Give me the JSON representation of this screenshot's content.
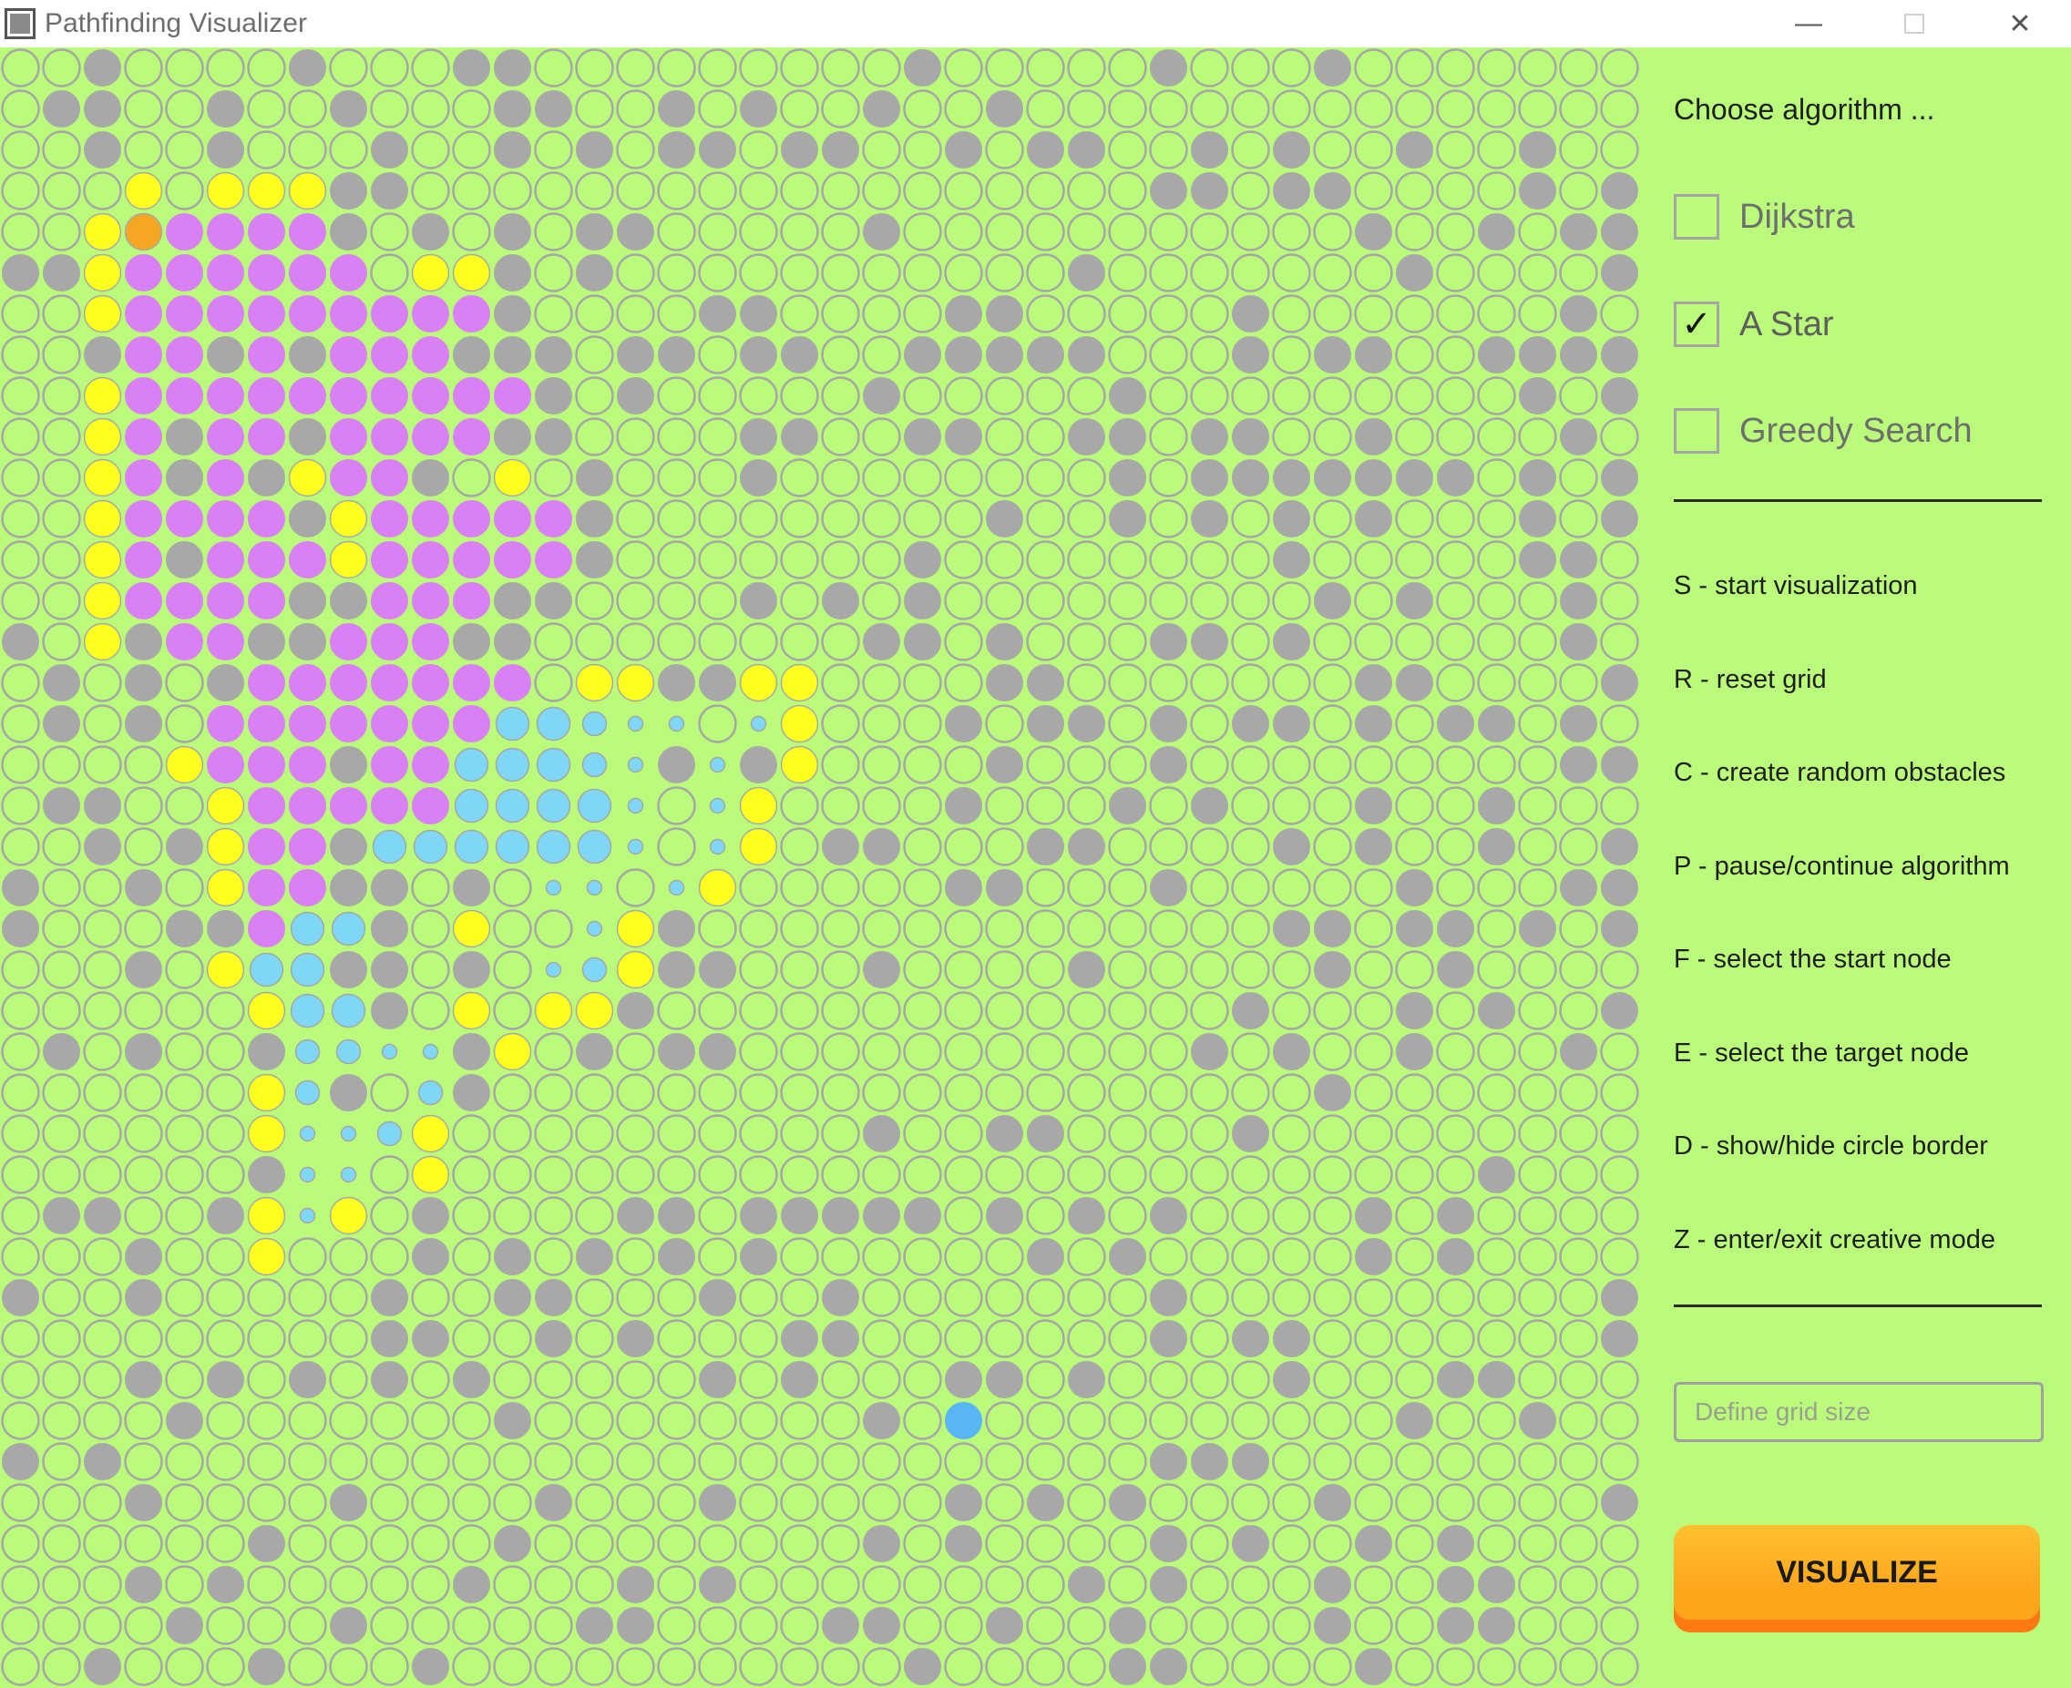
{
  "window": {
    "title": "Pathfinding Visualizer",
    "controls": {
      "minimize": "—",
      "close": "✕"
    }
  },
  "colors": {
    "background": "#bbfb7b",
    "empty_border": "#a6a6a6",
    "obstacle": "#a8a8a8",
    "path": "#ffff1f",
    "visited": "#d980f5",
    "frontier": "#7fd7f5",
    "start": "#f5a623",
    "target": "#58b6f5"
  },
  "grid": {
    "columns": 40,
    "rows": 40,
    "legend": {
      ".": "empty",
      "#": "obstacle",
      "Y": "path",
      "P": "visited",
      "B": "frontier",
      "b": "frontier-medium",
      "s": "frontier-small",
      "S": "start",
      "T": "target"
    },
    "rows_data": [
      "..#....#...##.........#.....#...#.......",
      ".##..#..#...##..#.#..#..#...............",
      "..#..#...#..#.#.##.##..#.##..#.#..#..#..",
      "...Y.YYY##..................##.##....#.#",
      "..YSPPPP#.#.#.##.....#...........#..#.##",
      "##YPPPPPP.YY#.#...........#.......#....#",
      "..YPPPPPPPPP#....##....##.....#.......#.",
      "..#PP#P#PPP###.##.##..#####...#.##..#####",
      "..YPPPPPPPPPP#.#.....#.....#.........#.#",
      "..YP#PP#PPPP##....##..##..##.##..#....#.",
      "..YP#P#YPP#.Y.#...#........#.#######.#.#",
      "..YPPPP#YPPPPP#.........#..#.#.#.#...#.#",
      "..YP#PPPYPPPPP#.......#........#.....##.",
      "..YPPPP##PPP##....#.#.#.........#.#...#.",
      "#.Y#PP##PPP##........##.#...##.#......#.",
      ".#.#.#PPPPPPP.YY##YY....##.......##....#",
      ".#.#.PPPPPPPBBbss.sY...#.##.#.##.#.##.#.",
      "....YPPP#PPBBBbs#s#Y....#...#.........##",
      ".##..YPPPPPBBBBs.sY....#...#.#...#..#...",
      "..#.#YPP#BBBBBBs.sY.##...##....#.#..#..#",
      "#..#.YPP##.#.ss.sY.....##...#.....#...##",
      "#...##PBB#.Y..sY#..............##.##.#.#",
      "...#.YBB##.#.sbY##...#....#.....#..#....",
      "......YBB#.Y.YY#..............#...#.#..#",
      ".#.#..#bbss#Y.#.##...........#.#..#...#.",
      "......Yb#.b#....................#.......",
      "......YssbY..........#..##....#.........",
      "......#ss.Y.........................#...",
      ".##..#YsY.#....##.#####.#.#.#....#.#....",
      "...#..Y...#.#.#.#.#......#.#.....#.#....",
      "#..#.....#..##...#..#.......#..........#",
      ".........##..#.#...##.......#.##.......#",
      "...#.#.#.#.#.....#.#...##.#....#...##...",
      "....#.......#........#.T..........#..#..",
      "#.#.........................###.........",
      "...#....#....#...#.....#.#.#....#......#",
      "......#.....#........#.#....#.#..#.#....",
      "...#.#.....#...#.#........#.#...#..##...",
      "....#...#.....##....##..#..#....#..##...",
      "..#...#...#...........#....##....#......"
    ]
  },
  "sidebar": {
    "heading": "Choose algorithm ...",
    "algorithms": [
      {
        "label": "Dijkstra",
        "checked": false,
        "mark": ""
      },
      {
        "label": "A Star",
        "checked": true,
        "mark": "✓"
      },
      {
        "label": "Greedy Search",
        "checked": false,
        "mark": ""
      }
    ],
    "shortcuts": [
      "S - start visualization",
      "R -  reset grid",
      "C - create random obstacles",
      "P - pause/continue algorithm",
      "F - select the start node",
      "E - select the target node",
      "D - show/hide circle border",
      "Z - enter/exit creative mode"
    ],
    "grid_size_placeholder": "Define grid size",
    "grid_size_value": "",
    "visualize_label": "VISUALIZE"
  }
}
